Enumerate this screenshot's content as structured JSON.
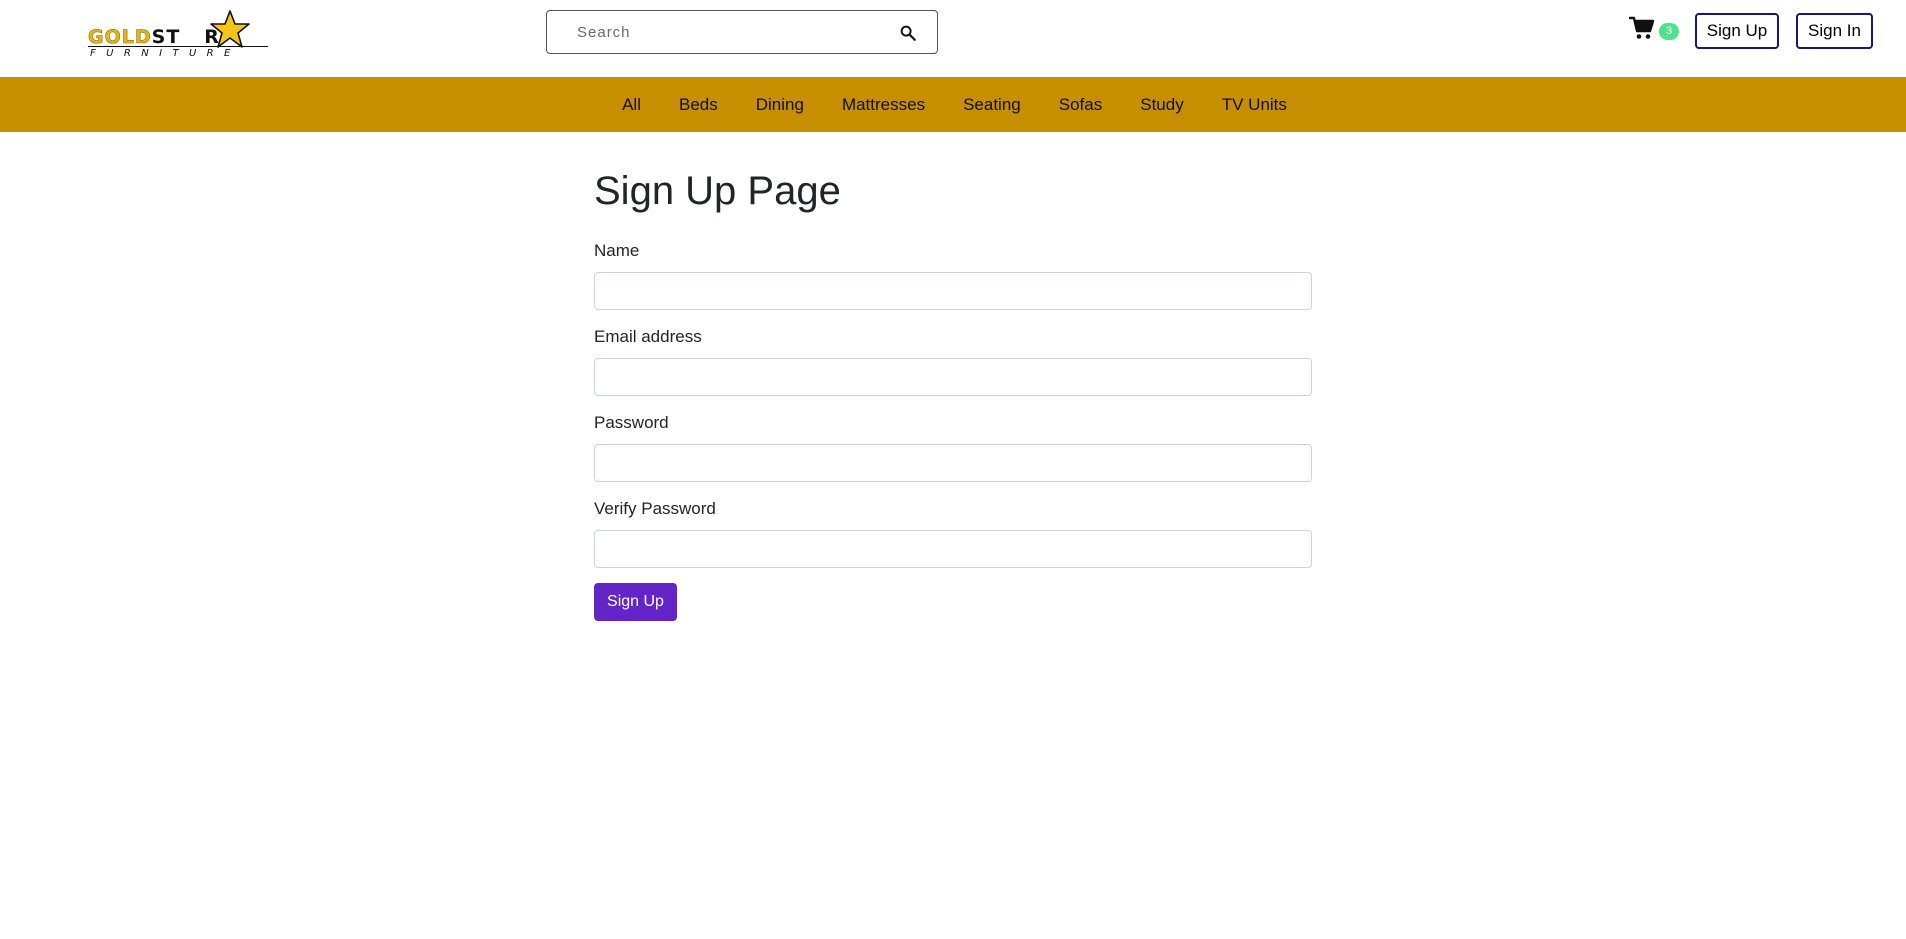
{
  "brand": {
    "word_gold": "GOLD",
    "word_star": "ST",
    "word_end": "R",
    "subtitle": "FURNITURE",
    "gold_color": "#e8b51c",
    "star_color": "#f5c518"
  },
  "search": {
    "placeholder": "Search",
    "value": "",
    "icon": "search-icon"
  },
  "cart": {
    "icon": "cart-icon",
    "count": "3",
    "badge_color": "#4ee28c"
  },
  "auth": {
    "signup_label": "Sign Up",
    "signin_label": "Sign In"
  },
  "nav": {
    "background": "#c68e00",
    "items": [
      "All",
      "Beds",
      "Dining",
      "Mattresses",
      "Seating",
      "Sofas",
      "Study",
      "TV Units"
    ]
  },
  "form": {
    "title": "Sign Up Page",
    "fields": [
      {
        "label": "Name",
        "value": ""
      },
      {
        "label": "Email address",
        "value": ""
      },
      {
        "label": "Password",
        "value": ""
      },
      {
        "label": "Verify Password",
        "value": ""
      }
    ],
    "submit_label": "Sign Up",
    "submit_color": "#6325c8"
  }
}
